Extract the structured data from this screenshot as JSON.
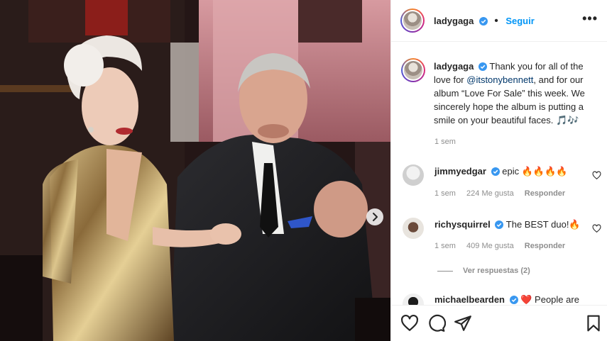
{
  "post": {
    "author": "ladygaga",
    "follow_label": "Seguir",
    "more_label": "•••",
    "caption": {
      "username": "ladygaga",
      "text_before": "Thank you for all of the love for ",
      "mention": "@itstonybennett",
      "text_after": ", and for our album “Love For Sale” this week. We sincerely hope the album is putting a smile on your beautiful faces. 🎵🎶",
      "time": "1 sem"
    }
  },
  "comments": [
    {
      "username": "jimmyedgar",
      "text": "epic 🔥🔥🔥🔥",
      "time": "1 sem",
      "likes": "224 Me gusta",
      "reply_label": "Responder"
    },
    {
      "username": "richysquirrel",
      "text": "The BEST duo!🔥",
      "time": "1 sem",
      "likes": "409 Me gusta",
      "reply_label": "Responder",
      "view_replies": "Ver respuestas (2)"
    },
    {
      "username": "michaelbearden",
      "text": "❤️ People are"
    }
  ],
  "icons": {
    "verified": "verified-badge-icon",
    "like": "heart-icon",
    "comment": "comment-bubble-icon",
    "share": "paper-plane-icon",
    "save": "bookmark-icon",
    "next": "chevron-right-icon",
    "more": "ellipsis-icon"
  },
  "colors": {
    "link": "#0095f6",
    "verified": "#3897f0",
    "meta": "#8e8e8e",
    "text": "#262626"
  }
}
